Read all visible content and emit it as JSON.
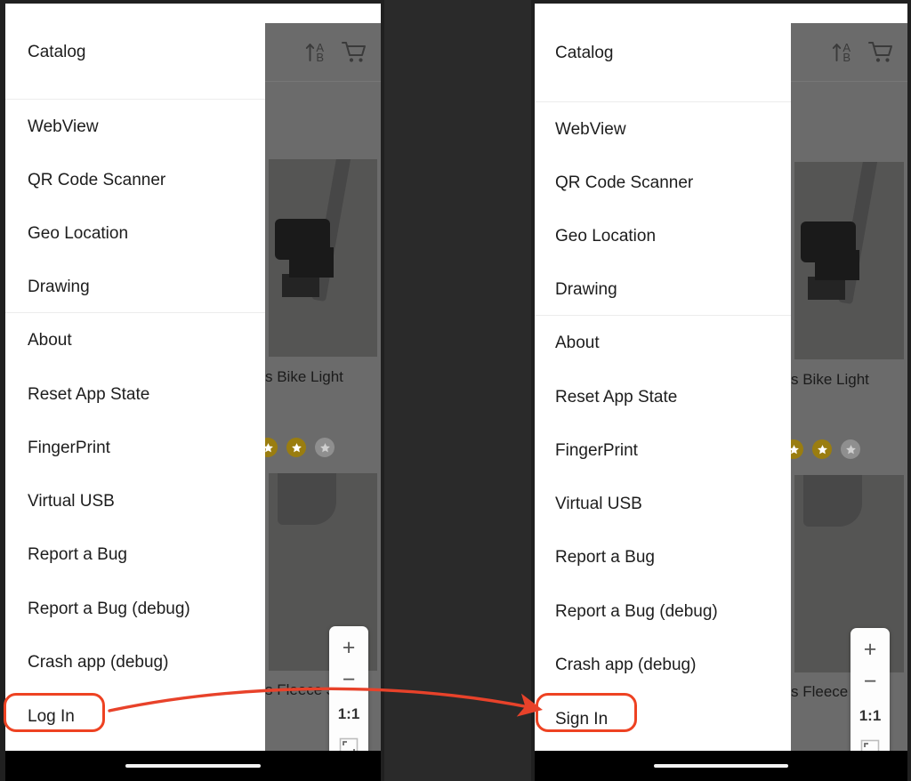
{
  "annotation": {
    "highlight_color": "#ee4222",
    "arrow_color": "#e8422a",
    "arrow_direction": "left-to-right",
    "before_label": "Log In",
    "after_label": "Sign In"
  },
  "panels": [
    {
      "side": "left",
      "variant": "before",
      "appbar": {
        "sort_icon": "sort-alpha-ascending-icon",
        "sort_letters": [
          "A",
          "B"
        ],
        "cart_icon": "shopping-cart-icon"
      },
      "drawer": {
        "items": [
          {
            "label": "Catalog",
            "highlighted": false
          },
          {
            "label": "WebView",
            "highlighted": false
          },
          {
            "label": "QR Code Scanner",
            "highlighted": false
          },
          {
            "label": "Geo Location",
            "highlighted": false
          },
          {
            "label": "Drawing",
            "highlighted": false
          },
          {
            "label": "About",
            "highlighted": false
          },
          {
            "label": "Reset App State",
            "highlighted": false
          },
          {
            "label": "FingerPrint",
            "highlighted": false
          },
          {
            "label": "Virtual USB",
            "highlighted": false
          },
          {
            "label": "Report a Bug",
            "highlighted": false
          },
          {
            "label": "Report a Bug (debug)",
            "highlighted": false
          },
          {
            "label": "Crash app (debug)",
            "highlighted": false
          },
          {
            "label": "Log In",
            "highlighted": true
          }
        ]
      },
      "content": {
        "products": [
          {
            "title": "s Bike Light",
            "image": "bike-light-photo",
            "stars_full": 2,
            "stars_empty": 1
          },
          {
            "title": "s Fleece J",
            "image": "fleece-jacket-photo",
            "stars_full": 2,
            "stars_empty": 1
          }
        ]
      },
      "zoom_widget": {
        "zoom_in": "+",
        "zoom_out": "−",
        "reset_label": "1:1",
        "fit_icon": "fit-to-screen-icon"
      }
    },
    {
      "side": "right",
      "variant": "after",
      "appbar": {
        "sort_icon": "sort-alpha-ascending-icon",
        "sort_letters": [
          "A",
          "B"
        ],
        "cart_icon": "shopping-cart-icon"
      },
      "drawer": {
        "items": [
          {
            "label": "Catalog",
            "highlighted": false
          },
          {
            "label": "WebView",
            "highlighted": false
          },
          {
            "label": "QR Code Scanner",
            "highlighted": false
          },
          {
            "label": "Geo Location",
            "highlighted": false
          },
          {
            "label": "Drawing",
            "highlighted": false
          },
          {
            "label": "About",
            "highlighted": false
          },
          {
            "label": "Reset App State",
            "highlighted": false
          },
          {
            "label": "FingerPrint",
            "highlighted": false
          },
          {
            "label": "Virtual USB",
            "highlighted": false
          },
          {
            "label": "Report a Bug",
            "highlighted": false
          },
          {
            "label": "Report a Bug (debug)",
            "highlighted": false
          },
          {
            "label": "Crash app (debug)",
            "highlighted": false
          },
          {
            "label": "Sign In",
            "highlighted": true
          }
        ]
      },
      "content": {
        "products": [
          {
            "title": "s Bike Light",
            "image": "bike-light-photo",
            "stars_full": 2,
            "stars_empty": 1
          },
          {
            "title": "s Fleece Ja",
            "image": "fleece-jacket-photo",
            "stars_full": 2,
            "stars_empty": 1
          }
        ]
      },
      "zoom_widget": {
        "zoom_in": "+",
        "zoom_out": "−",
        "reset_label": "1:1",
        "fit_icon": "fit-to-screen-icon"
      }
    }
  ]
}
